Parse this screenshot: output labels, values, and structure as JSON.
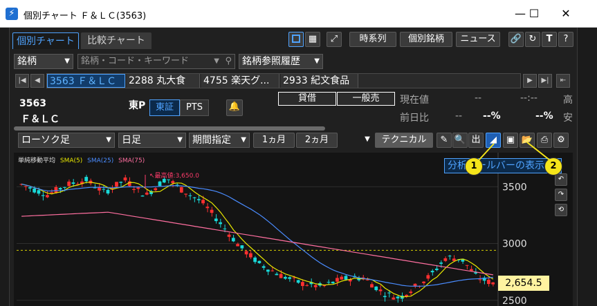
{
  "window": {
    "title": "個別チャート Ｆ＆ＬＣ(3563)",
    "minimize": "—",
    "maximize": "☐",
    "close": "✕"
  },
  "tabs": [
    {
      "label": "個別チャート",
      "active": true
    },
    {
      "label": "比較チャート",
      "active": false
    }
  ],
  "header_buttons": {
    "timeseries": "時系列",
    "individual": "個別銘柄",
    "news": "ニュース",
    "text_tool": "T",
    "help": "?"
  },
  "row2": {
    "brand_label": "銘柄",
    "search_placeholder": "銘柄・コード・キーワード",
    "history_label": "銘柄参照履歴"
  },
  "stocks": [
    {
      "label": "3563 Ｆ＆ＬＣ",
      "active": true
    },
    {
      "label": "2288 丸大食",
      "active": false
    },
    {
      "label": "4755 楽天グ...",
      "active": false
    },
    {
      "label": "2933 紀文食品",
      "active": false
    }
  ],
  "info": {
    "code": "3563",
    "name": "Ｆ＆ＬＣ",
    "market_label": "東P",
    "market_active": "東証",
    "pts": "PTS",
    "lending": "貸借",
    "general_margin": "一般売",
    "current_price_label": "現在値",
    "current_price": "--",
    "current_time": "--:--",
    "prev_diff_label": "前日比",
    "prev_diff": "--",
    "prev_diff_pct": "--%",
    "prev_diff_pct2": "--%",
    "high_label": "高",
    "low_label": "安"
  },
  "toolbar": {
    "candle_type": "ローソク足",
    "period_type": "日足",
    "range_type": "期間指定",
    "range_1m": "1ヵ月",
    "range_2m": "2ヵ月",
    "technical": "テクニカル",
    "out_label": "出"
  },
  "tooltip": {
    "text": "分析ツールバーの表示"
  },
  "badges": [
    "1",
    "2"
  ],
  "chart_data": {
    "type": "line",
    "title": "単純移動平均",
    "series": [
      {
        "name": "SMA(5)",
        "color": "#e8e800"
      },
      {
        "name": "SMA(25)",
        "color": "#4a8cff"
      },
      {
        "name": "SMA(75)",
        "color": "#ff6fa0"
      }
    ],
    "annotation": "最高値:3,650.0",
    "y_ticks": [
      "3500",
      "3000",
      "2500"
    ],
    "ylim": [
      2450,
      3800
    ],
    "last_price": "2,654.5",
    "reference_line": 2940
  },
  "colors": {
    "up": "#ff3030",
    "down": "#19d9d9",
    "accent": "#4fa3ff"
  }
}
